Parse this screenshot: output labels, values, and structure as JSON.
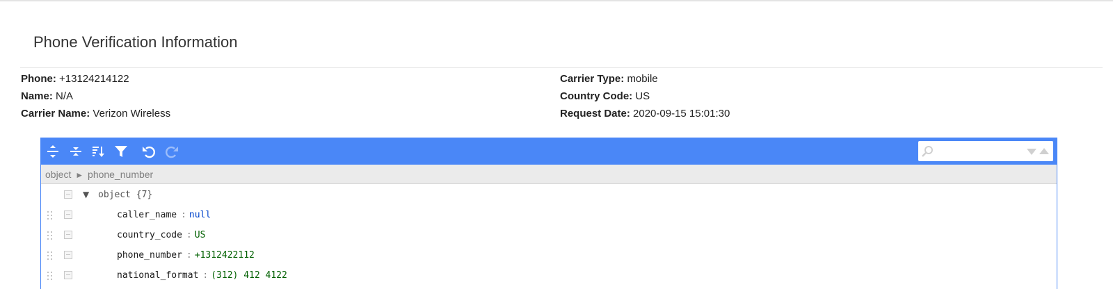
{
  "page": {
    "title": "Phone Verification Information"
  },
  "info": {
    "left": [
      {
        "label": "Phone:",
        "value": "+13124214122"
      },
      {
        "label": "Name:",
        "value": "N/A"
      },
      {
        "label": "Carrier Name:",
        "value": "Verizon Wireless"
      }
    ],
    "right": [
      {
        "label": "Carrier Type:",
        "value": "mobile"
      },
      {
        "label": "Country Code:",
        "value": "US"
      },
      {
        "label": "Request Date:",
        "value": "2020-09-15 15:01:30"
      }
    ]
  },
  "editor": {
    "toolbar": {
      "buttons": [
        "expand-all",
        "collapse-all",
        "sort",
        "filter",
        "undo",
        "redo"
      ],
      "accent_color": "#4a87f7"
    },
    "search": {
      "placeholder": "",
      "value": ""
    },
    "navbar": {
      "root": "object",
      "separator": "►",
      "current": "phone_number"
    },
    "tree": {
      "root_label": "object",
      "root_count": "{7}",
      "rows": [
        {
          "key": "caller_name",
          "value": "null",
          "type": "null"
        },
        {
          "key": "country_code",
          "value": "US",
          "type": "string"
        },
        {
          "key": "phone_number",
          "value": "+1312422112",
          "type": "string"
        },
        {
          "key": "national_format",
          "value": "(312) 412 4122",
          "type": "string"
        }
      ]
    }
  }
}
